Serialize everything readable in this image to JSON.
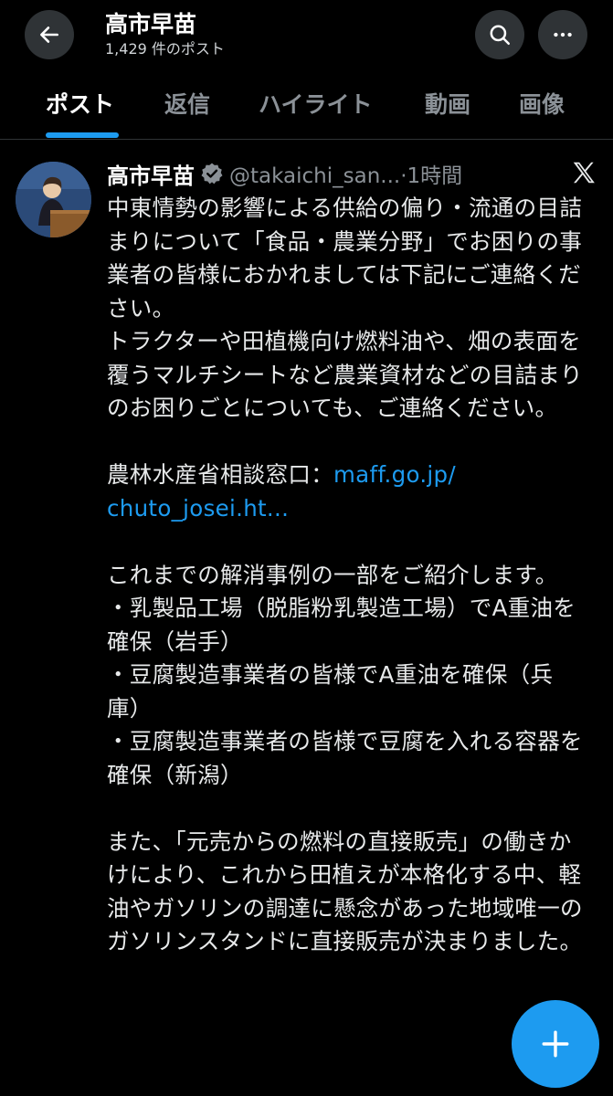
{
  "header": {
    "title": "高市早苗",
    "subtitle": "1,429 件のポスト",
    "back_icon": "arrow-left-icon",
    "search_icon": "search-icon",
    "more_icon": "more-horizontal-icon"
  },
  "tabs": [
    {
      "label": "ポスト",
      "active": true
    },
    {
      "label": "返信",
      "active": false
    },
    {
      "label": "ハイライト",
      "active": false
    },
    {
      "label": "動画",
      "active": false
    },
    {
      "label": "画像",
      "active": false
    }
  ],
  "post": {
    "author": "高市早苗",
    "verified": true,
    "handle_time": "@takaichi_san...·1時間",
    "body_1": "中東情勢の影響による供給の偏り・流通の目詰まりについて「食品・農業分野」でお困りの事業者の皆様におかれましては下記にご連絡ください。\nトラクターや田植機向け燃料油や、畑の表面を覆うマルチシートなど農業資材などの目詰まりのお困りごとについても、ご連絡ください。\n\n農林水産省相談窓口：",
    "link_1": "maff.go.jp/",
    "link_2": "chuto_josei.ht...",
    "body_2": "\n\nこれまでの解消事例の一部をご紹介します。\n・乳製品工場（脱脂粉乳製造工場）でA重油を確保（岩手）\n・豆腐製造事業者の皆様でA重油を確保（兵庫）\n・豆腐製造事業者の皆様で豆腐を入れる容器を確保（新潟）\n\nまた、「元売からの燃料の直接販売」の働きかけにより、これから田植えが本格化する中、軽油やガソリンの調達に懸念があった地域唯一のガソリンスタンドに直接販売が決まりました。"
  },
  "fab_icon": "plus-icon",
  "colors": {
    "accent": "#1d9bf0",
    "background": "#000000",
    "muted": "#8b9197"
  }
}
